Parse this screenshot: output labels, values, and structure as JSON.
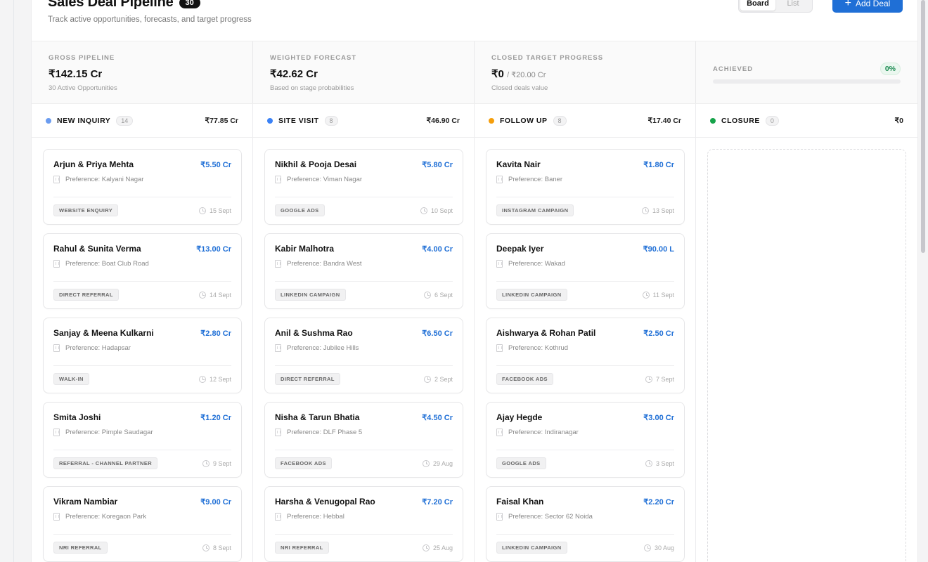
{
  "header": {
    "title": "Sales Deal Pipeline",
    "count": "30",
    "subtitle": "Track active opportunities, forecasts, and target progress",
    "view_board": "Board",
    "view_list": "List",
    "add_deal": "Add Deal"
  },
  "stats": {
    "gross": {
      "label": "GROSS PIPELINE",
      "value": "₹142.15 Cr",
      "note": "30 Active Opportunities"
    },
    "weighted": {
      "label": "WEIGHTED FORECAST",
      "value": "₹42.62 Cr",
      "note": "Based on stage probabilities"
    },
    "closed": {
      "label": "CLOSED TARGET PROGRESS",
      "value": "₹0",
      "suffix": "/ ₹20.00 Cr",
      "note": "Closed deals value"
    },
    "achieved": {
      "label": "ACHIEVED",
      "percent": "0%",
      "fraction": 0
    }
  },
  "colors": {
    "accent": "#1f6fd6",
    "new_inquiry": "#6b9cf0",
    "site_visit": "#3b82f6",
    "follow_up": "#f59e0b",
    "closure": "#16a34a"
  },
  "columns": [
    {
      "name": "NEW INQUIRY",
      "count": "14",
      "total": "₹77.85 Cr",
      "dot": "#6b9cf0",
      "cards": [
        {
          "name": "Arjun & Priya Mehta",
          "amount": "₹5.50 Cr",
          "pref": "Preference: Kalyani Nagar",
          "source": "WEBSITE ENQUIRY",
          "date": "15 Sept"
        },
        {
          "name": "Rahul & Sunita Verma",
          "amount": "₹13.00 Cr",
          "pref": "Preference: Boat Club Road",
          "source": "DIRECT REFERRAL",
          "date": "14 Sept"
        },
        {
          "name": "Sanjay & Meena Kulkarni",
          "amount": "₹2.80 Cr",
          "pref": "Preference: Hadapsar",
          "source": "WALK-IN",
          "date": "12 Sept"
        },
        {
          "name": "Smita Joshi",
          "amount": "₹1.20 Cr",
          "pref": "Preference: Pimple Saudagar",
          "source": "REFERRAL - CHANNEL PARTNER",
          "date": "9 Sept"
        },
        {
          "name": "Vikram Nambiar",
          "amount": "₹9.00 Cr",
          "pref": "Preference: Koregaon Park",
          "source": "NRI REFERRAL",
          "date": "8 Sept"
        }
      ]
    },
    {
      "name": "SITE VISIT",
      "count": "8",
      "total": "₹46.90 Cr",
      "dot": "#3b82f6",
      "cards": [
        {
          "name": "Nikhil & Pooja Desai",
          "amount": "₹5.80 Cr",
          "pref": "Preference: Viman Nagar",
          "source": "GOOGLE ADS",
          "date": "10 Sept"
        },
        {
          "name": "Kabir Malhotra",
          "amount": "₹4.00 Cr",
          "pref": "Preference: Bandra West",
          "source": "LINKEDIN CAMPAIGN",
          "date": "6 Sept"
        },
        {
          "name": "Anil & Sushma Rao",
          "amount": "₹6.50 Cr",
          "pref": "Preference: Jubilee Hills",
          "source": "DIRECT REFERRAL",
          "date": "2 Sept"
        },
        {
          "name": "Nisha & Tarun Bhatia",
          "amount": "₹4.50 Cr",
          "pref": "Preference: DLF Phase 5",
          "source": "FACEBOOK ADS",
          "date": "29 Aug"
        },
        {
          "name": "Harsha & Venugopal Rao",
          "amount": "₹7.20 Cr",
          "pref": "Preference: Hebbal",
          "source": "NRI REFERRAL",
          "date": "25 Aug"
        }
      ]
    },
    {
      "name": "FOLLOW UP",
      "count": "8",
      "total": "₹17.40 Cr",
      "dot": "#f59e0b",
      "cards": [
        {
          "name": "Kavita Nair",
          "amount": "₹1.80 Cr",
          "pref": "Preference: Baner",
          "source": "INSTAGRAM CAMPAIGN",
          "date": "13 Sept"
        },
        {
          "name": "Deepak Iyer",
          "amount": "₹90.00 L",
          "pref": "Preference: Wakad",
          "source": "LINKEDIN CAMPAIGN",
          "date": "11 Sept"
        },
        {
          "name": "Aishwarya & Rohan Patil",
          "amount": "₹2.50 Cr",
          "pref": "Preference: Kothrud",
          "source": "FACEBOOK ADS",
          "date": "7 Sept"
        },
        {
          "name": "Ajay Hegde",
          "amount": "₹3.00 Cr",
          "pref": "Preference: Indiranagar",
          "source": "GOOGLE ADS",
          "date": "3 Sept"
        },
        {
          "name": "Faisal Khan",
          "amount": "₹2.20 Cr",
          "pref": "Preference: Sector 62 Noida",
          "source": "LINKEDIN CAMPAIGN",
          "date": "30 Aug"
        }
      ]
    },
    {
      "name": "CLOSURE",
      "count": "0",
      "total": "₹0",
      "dot": "#16a34a",
      "cards": []
    }
  ]
}
